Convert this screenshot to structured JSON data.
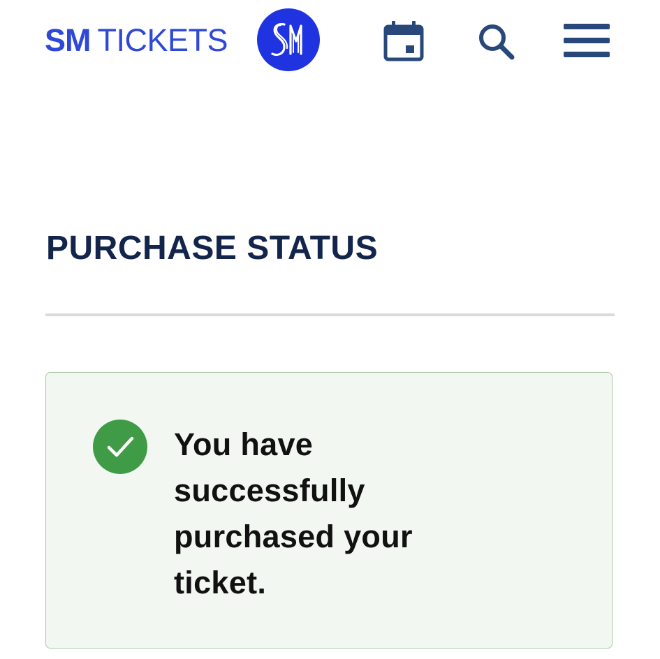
{
  "header": {
    "brand_bold": "SM",
    "brand_light": "TICKETS",
    "logo_icon": "sm-logo-icon",
    "nav_icons": [
      "calendar-icon",
      "search-icon",
      "menu-icon"
    ]
  },
  "main": {
    "title": "PURCHASE STATUS",
    "status": {
      "icon": "check-circle-icon",
      "message": "You have successfully purchased your ticket."
    }
  },
  "colors": {
    "brand_blue": "#2f49d6",
    "logo_blue": "#1f33e0",
    "nav_icon": "#28487a",
    "title": "#13254a",
    "success_green": "#3f9b46",
    "status_bg": "#f2f7f2",
    "status_border": "#a9c9a9",
    "divider": "#dadada"
  }
}
